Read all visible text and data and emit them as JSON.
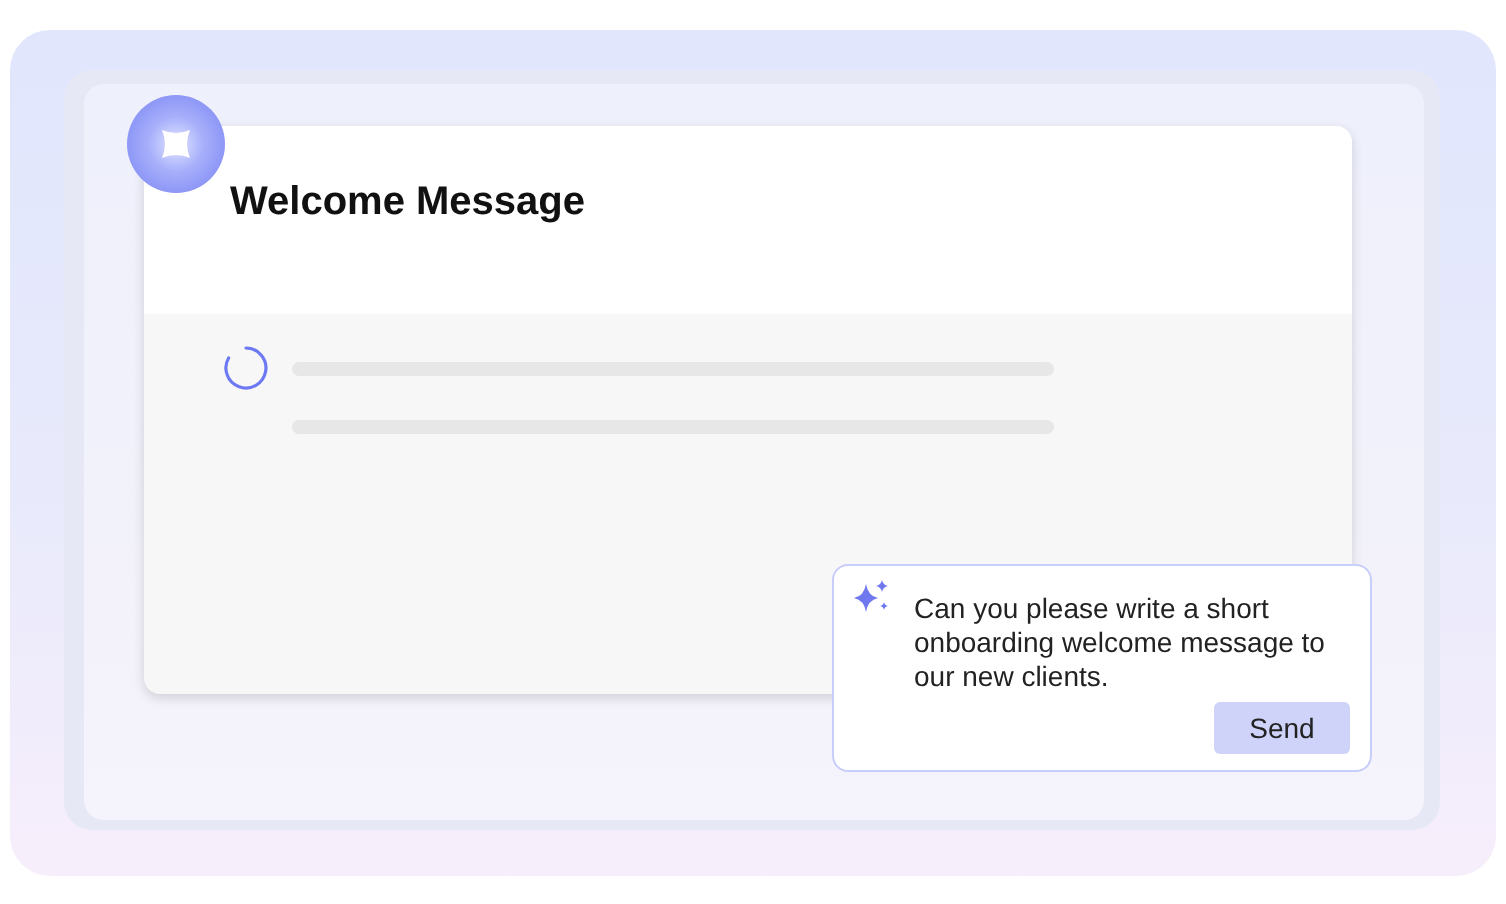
{
  "card": {
    "title": "Welcome Message",
    "loading": true
  },
  "prompt": {
    "text": "Can you please write a short onboarding welcome message to our new clients.",
    "button": "Send"
  }
}
